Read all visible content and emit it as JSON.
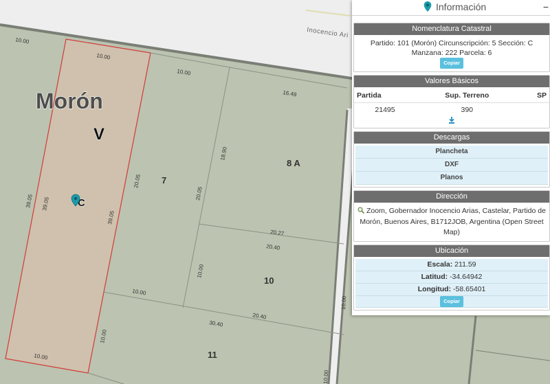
{
  "map": {
    "street_name": "Inocencio Ari",
    "district_label": "Morón",
    "circ_label": "V",
    "parcel_labels": [
      "C",
      "7",
      "8 A",
      "10",
      "11"
    ],
    "dimension_labels": [
      "10.00",
      "10.00",
      "10.00",
      "16.49",
      "18.90",
      "20.05",
      "20.05",
      "39.05",
      "39.05",
      "39.05",
      "20.27",
      "20.40",
      "10.00",
      "10.00",
      "20.40",
      "30.40",
      "10.00",
      "10.00",
      "10.00"
    ],
    "colors": {
      "block_fill": "#bcc3b0",
      "street_fill": "#eeeeee",
      "selected_fill": "#cfc1ad",
      "selected_outline": "#d23a3a",
      "block_line": "#8b9184",
      "marker": "#1b9aaa"
    },
    "marker_icon": "map-pin-icon"
  },
  "panel": {
    "title": "Información",
    "title_icon": "map-pin-icon",
    "collapse_symbol": "−",
    "nomenclatura": {
      "title": "Nomenclatura Catastral",
      "text": "Partido: 101 (Morón) Circunscripción: 5 Sección: C Manzana: 222 Parcela: 6",
      "copy_label": "Copiar"
    },
    "valores": {
      "title": "Valores Básicos",
      "headers": [
        "Partida",
        "Sup. Terreno",
        "SP"
      ],
      "row": [
        "21495",
        "390",
        ""
      ],
      "download_icon": "download-icon"
    },
    "descargas": {
      "title": "Descargas",
      "items": [
        "Plancheta",
        "DXF",
        "Planos"
      ]
    },
    "direccion": {
      "title": "Dirección",
      "icon": "zoom-icon",
      "text": "Zoom, Gobernador Inocencio Arias, Castelar, Partido de Morón, Buenos Aires, B1712JOB, Argentina (Open Street Map)"
    },
    "ubicacion": {
      "title": "Ubicación",
      "escala_label": "Escala:",
      "escala_value": "211.59",
      "latitud_label": "Latitud:",
      "latitud_value": "-34.64942",
      "longitud_label": "Longitud:",
      "longitud_value": "-58.65401",
      "copy_label": "Copiar"
    }
  }
}
